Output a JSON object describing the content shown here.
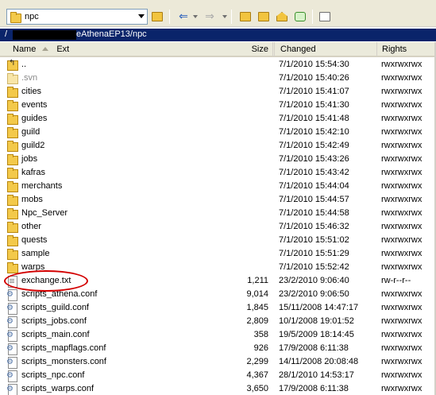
{
  "toolbar": {
    "current_dir": "npc",
    "icons": [
      "open-folder-icon",
      "back-arrow-icon",
      "forward-arrow-icon",
      "parent-dir-icon",
      "root-dir-icon",
      "home-icon",
      "refresh-icon",
      "tree-icon"
    ]
  },
  "path": {
    "prefix": "/",
    "suffix": "eAthenaEP13/npc"
  },
  "columns": {
    "name": "Name",
    "ext": "Ext",
    "size": "Size",
    "changed": "Changed",
    "rights": "Rights"
  },
  "files": [
    {
      "name": "..",
      "size": "",
      "changed": "7/1/2010 15:54:30",
      "rights": "rwxrwxrwx",
      "icon": "up-dir-icon"
    },
    {
      "name": ".svn",
      "size": "",
      "changed": "7/1/2010 15:40:26",
      "rights": "rwxrwxrwx",
      "icon": "hidden-folder-icon"
    },
    {
      "name": "cities",
      "size": "",
      "changed": "7/1/2010 15:41:07",
      "rights": "rwxrwxrwx",
      "icon": "folder-icon"
    },
    {
      "name": "events",
      "size": "",
      "changed": "7/1/2010 15:41:30",
      "rights": "rwxrwxrwx",
      "icon": "folder-icon"
    },
    {
      "name": "guides",
      "size": "",
      "changed": "7/1/2010 15:41:48",
      "rights": "rwxrwxrwx",
      "icon": "folder-icon"
    },
    {
      "name": "guild",
      "size": "",
      "changed": "7/1/2010 15:42:10",
      "rights": "rwxrwxrwx",
      "icon": "folder-icon"
    },
    {
      "name": "guild2",
      "size": "",
      "changed": "7/1/2010 15:42:49",
      "rights": "rwxrwxrwx",
      "icon": "folder-icon"
    },
    {
      "name": "jobs",
      "size": "",
      "changed": "7/1/2010 15:43:26",
      "rights": "rwxrwxrwx",
      "icon": "folder-icon"
    },
    {
      "name": "kafras",
      "size": "",
      "changed": "7/1/2010 15:43:42",
      "rights": "rwxrwxrwx",
      "icon": "folder-icon"
    },
    {
      "name": "merchants",
      "size": "",
      "changed": "7/1/2010 15:44:04",
      "rights": "rwxrwxrwx",
      "icon": "folder-icon"
    },
    {
      "name": "mobs",
      "size": "",
      "changed": "7/1/2010 15:44:57",
      "rights": "rwxrwxrwx",
      "icon": "folder-icon"
    },
    {
      "name": "Npc_Server",
      "size": "",
      "changed": "7/1/2010 15:44:58",
      "rights": "rwxrwxrwx",
      "icon": "folder-icon"
    },
    {
      "name": "other",
      "size": "",
      "changed": "7/1/2010 15:46:32",
      "rights": "rwxrwxrwx",
      "icon": "folder-icon"
    },
    {
      "name": "quests",
      "size": "",
      "changed": "7/1/2010 15:51:02",
      "rights": "rwxrwxrwx",
      "icon": "folder-icon"
    },
    {
      "name": "sample",
      "size": "",
      "changed": "7/1/2010 15:51:29",
      "rights": "rwxrwxrwx",
      "icon": "folder-icon"
    },
    {
      "name": "warps",
      "size": "",
      "changed": "7/1/2010 15:52:42",
      "rights": "rwxrwxrwx",
      "icon": "folder-icon"
    },
    {
      "name": "exchange.txt",
      "size": "1,211",
      "changed": "23/2/2010 9:06:40",
      "rights": "rw-r--r--",
      "icon": "text-file-icon"
    },
    {
      "name": "scripts_athena.conf",
      "size": "9,014",
      "changed": "23/2/2010 9:06:50",
      "rights": "rwxrwxrwx",
      "icon": "conf-file-icon"
    },
    {
      "name": "scripts_guild.conf",
      "size": "1,845",
      "changed": "15/11/2008 14:47:17",
      "rights": "rwxrwxrwx",
      "icon": "conf-file-icon"
    },
    {
      "name": "scripts_jobs.conf",
      "size": "2,809",
      "changed": "10/1/2008 19:01:52",
      "rights": "rwxrwxrwx",
      "icon": "conf-file-icon"
    },
    {
      "name": "scripts_main.conf",
      "size": "358",
      "changed": "19/5/2009 18:14:45",
      "rights": "rwxrwxrwx",
      "icon": "conf-file-icon"
    },
    {
      "name": "scripts_mapflags.conf",
      "size": "926",
      "changed": "17/9/2008 6:11:38",
      "rights": "rwxrwxrwx",
      "icon": "conf-file-icon"
    },
    {
      "name": "scripts_monsters.conf",
      "size": "2,299",
      "changed": "14/11/2008 20:08:48",
      "rights": "rwxrwxrwx",
      "icon": "conf-file-icon"
    },
    {
      "name": "scripts_npc.conf",
      "size": "4,367",
      "changed": "28/1/2010 14:53:17",
      "rights": "rwxrwxrwx",
      "icon": "conf-file-icon"
    },
    {
      "name": "scripts_warps.conf",
      "size": "3,650",
      "changed": "17/9/2008 6:11:38",
      "rights": "rwxrwxrwx",
      "icon": "conf-file-icon"
    }
  ],
  "colors": {
    "path_bar": "#0a246a",
    "annotation": "#d30000",
    "folder": "#f3c94a"
  }
}
